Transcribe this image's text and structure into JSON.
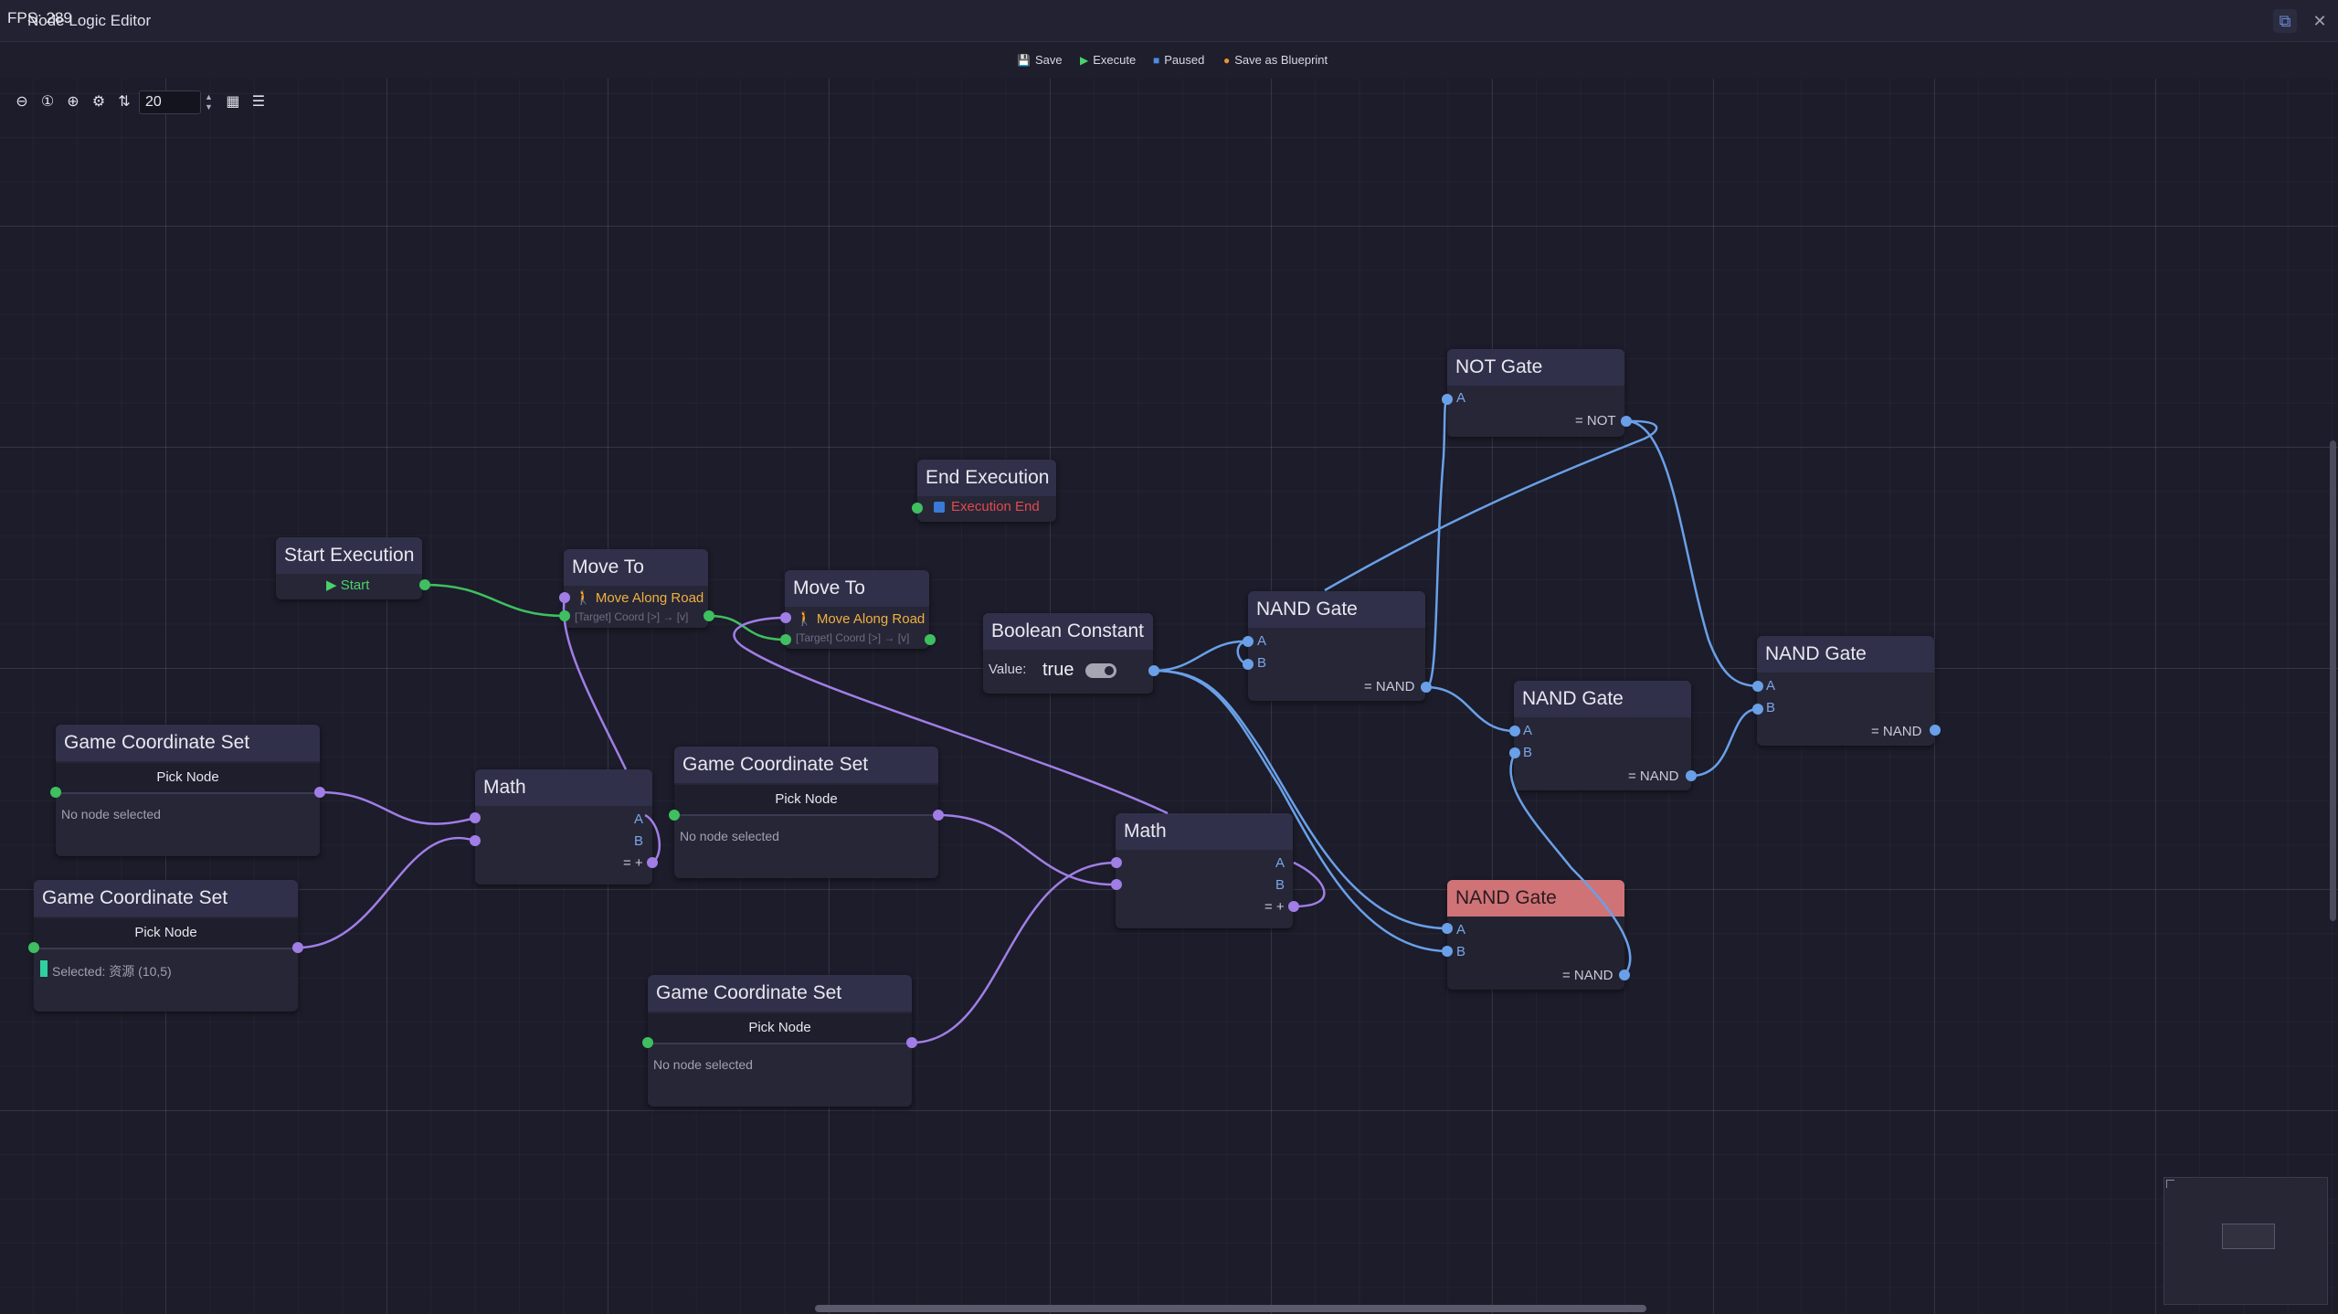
{
  "window": {
    "fps": "FPS: 289",
    "title": "Node Logic Editor",
    "restore_glyph": "⧉",
    "close_glyph": "✕"
  },
  "toolbar": {
    "save": {
      "label": "Save",
      "icon": "💾"
    },
    "execute": {
      "label": "Execute",
      "icon": "▶"
    },
    "paused": {
      "label": "Paused",
      "icon": "■"
    },
    "blueprint": {
      "label": "Save as Blueprint",
      "icon": "●"
    }
  },
  "zoom": {
    "value": "20"
  },
  "nodes": {
    "start_execution": {
      "title": "Start Execution",
      "port": "▶ Start"
    },
    "move_to_1": {
      "title": "Move To",
      "action": "🚶 Move Along Road",
      "detail": "[Target] Coord [>] → [v]"
    },
    "move_to_2": {
      "title": "Move To",
      "action": "🚶 Move Along Road",
      "detail": "[Target] Coord [>] → [v]"
    },
    "end_execution": {
      "title": "End Execution",
      "port": "Execution End"
    },
    "boolean_constant": {
      "title": "Boolean Constant",
      "value_label": "Value:",
      "value": "true"
    },
    "gcs_1": {
      "title": "Game Coordinate Set",
      "button": "Pick Node",
      "status": "No node selected"
    },
    "gcs_2": {
      "title": "Game Coordinate Set",
      "button": "Pick Node",
      "status": "Selected: 资源 (10,5)"
    },
    "gcs_3": {
      "title": "Game Coordinate Set",
      "button": "Pick Node",
      "status": "No node selected"
    },
    "gcs_4": {
      "title": "Game Coordinate Set",
      "button": "Pick Node",
      "status": "No node selected"
    },
    "math_1": {
      "title": "Math",
      "in_a": "A",
      "in_b": "B",
      "out": "= +"
    },
    "math_2": {
      "title": "Math",
      "in_a": "A",
      "in_b": "B",
      "out": "= +"
    },
    "not_gate": {
      "title": "NOT Gate",
      "in_a": "A",
      "out": "= NOT"
    },
    "nand_1": {
      "title": "NAND Gate",
      "in_a": "A",
      "in_b": "B",
      "out": "= NAND"
    },
    "nand_2": {
      "title": "NAND Gate",
      "in_a": "A",
      "in_b": "B",
      "out": "= NAND"
    },
    "nand_3": {
      "title": "NAND Gate",
      "in_a": "A",
      "in_b": "B",
      "out": "= NAND"
    },
    "nand_4": {
      "title": "NAND Gate",
      "in_a": "A",
      "in_b": "B",
      "out": "= NAND"
    }
  },
  "colors": {
    "exec_wire": "#3fbf5f",
    "coord_wire": "#a07ee6",
    "bool_wire": "#6aa0e8",
    "selected_header": "#cf7377"
  }
}
